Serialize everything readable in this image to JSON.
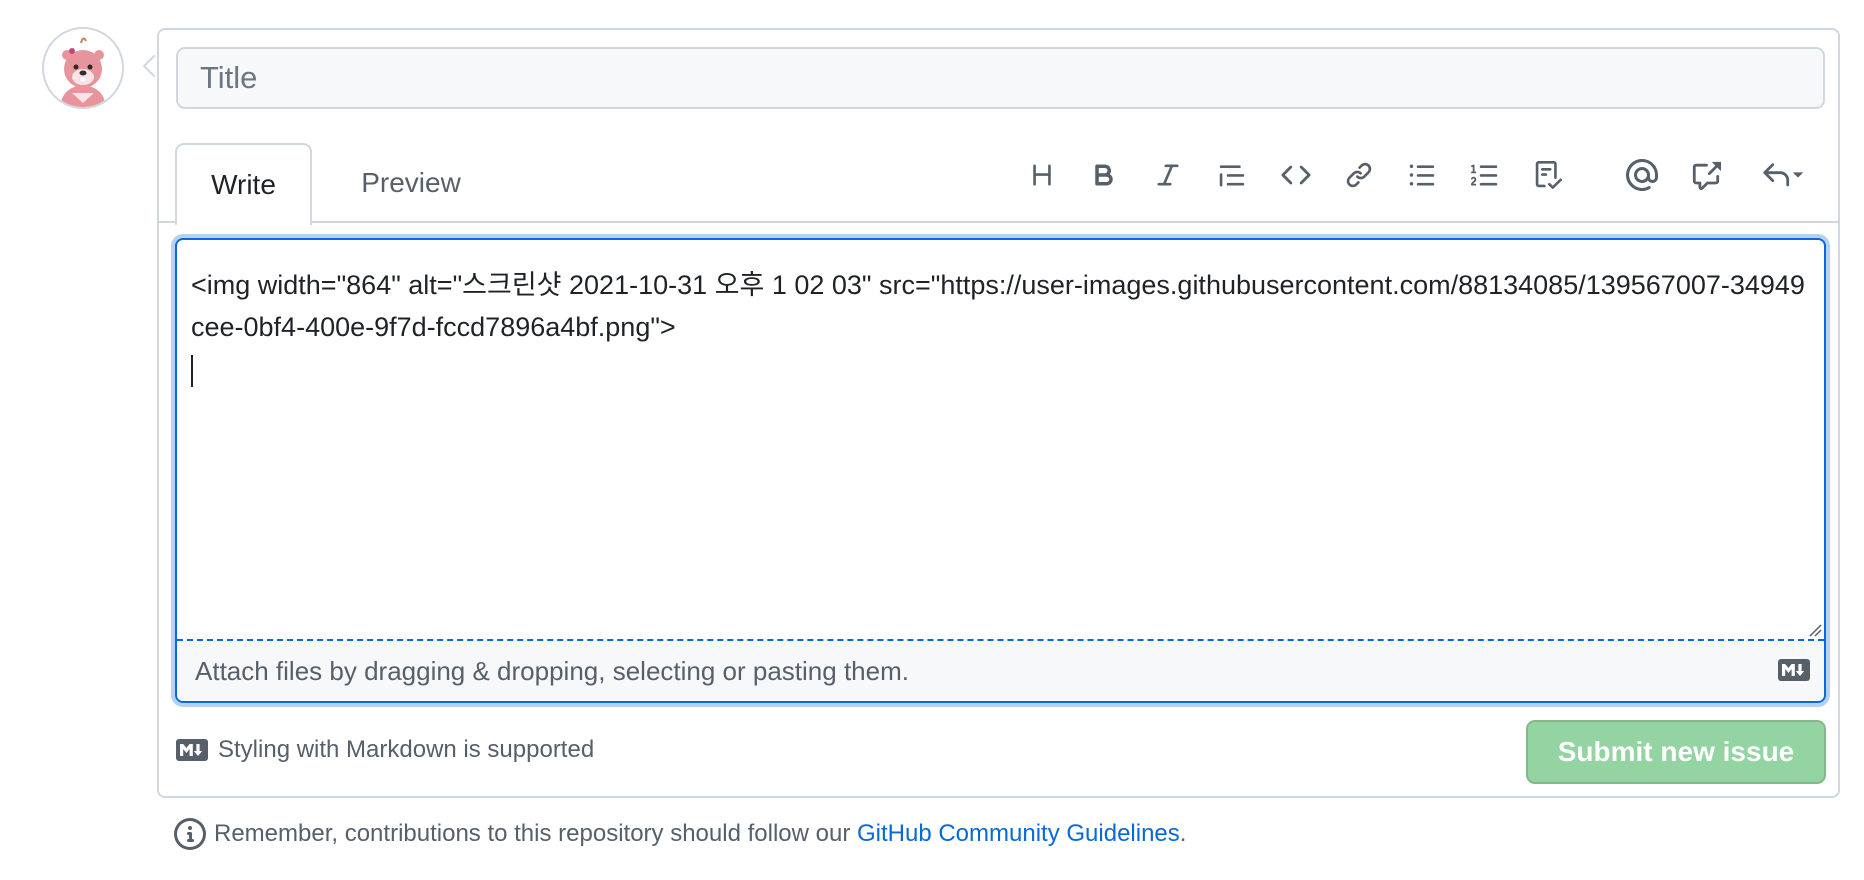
{
  "avatar": {
    "alt": "user avatar",
    "icon": "beaver-avatar"
  },
  "title_field": {
    "placeholder": "Title",
    "value": ""
  },
  "tabs": [
    {
      "label": "Write",
      "active": true
    },
    {
      "label": "Preview",
      "active": false
    }
  ],
  "toolbar": [
    {
      "name": "heading",
      "icon": "heading-icon"
    },
    {
      "name": "bold",
      "icon": "bold-icon"
    },
    {
      "name": "italic",
      "icon": "italic-icon"
    },
    {
      "name": "quote",
      "icon": "quote-icon"
    },
    {
      "name": "code",
      "icon": "code-icon"
    },
    {
      "name": "link",
      "icon": "link-icon"
    },
    {
      "name": "unordered-list",
      "icon": "unordered-list-icon"
    },
    {
      "name": "ordered-list",
      "icon": "ordered-list-icon"
    },
    {
      "name": "task-list",
      "icon": "task-list-icon"
    },
    {
      "name": "mention",
      "icon": "mention-icon"
    },
    {
      "name": "reference",
      "icon": "cross-reference-icon"
    },
    {
      "name": "saved-replies",
      "icon": "reply-icon"
    }
  ],
  "editor": {
    "content": "<img width=\"864\" alt=\"스크린샷 2021-10-31 오후 1 02 03\" src=\"https://user-images.githubusercontent.com/88134085/139567007-34949cee-0bf4-400e-9f7d-fccd7896a4bf.png\">\n",
    "attach_hint": "Attach files by dragging & dropping, selecting or pasting them."
  },
  "footer": {
    "markdown_note": "Styling with Markdown is supported",
    "submit_label": "Submit new issue",
    "submit_enabled": false
  },
  "notice": {
    "text": "Remember, contributions to this repository should follow our ",
    "link_text": "GitHub Community Guidelines",
    "suffix": "."
  },
  "colors": {
    "accent": "#0969da",
    "submit_disabled": "#94d3a2",
    "border": "#d0d7de",
    "muted_text": "#57606a"
  }
}
